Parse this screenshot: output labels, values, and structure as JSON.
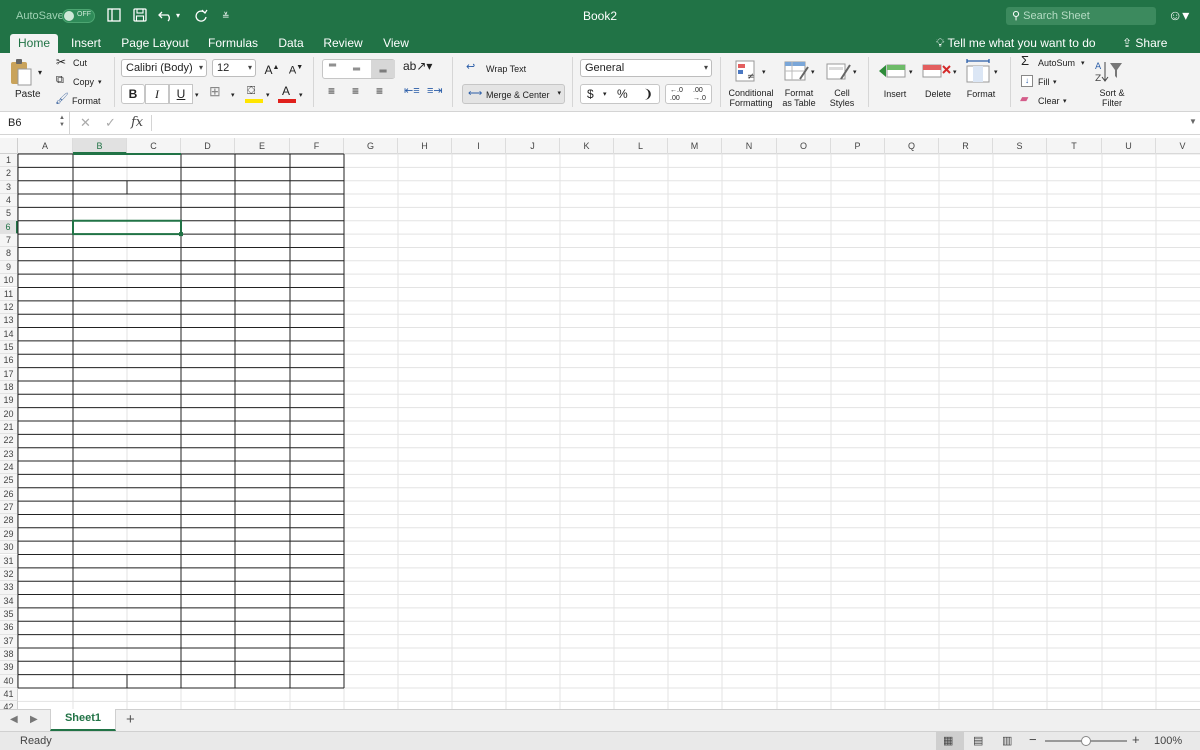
{
  "titlebar": {
    "autosave_label": "AutoSave",
    "autosave_state": "OFF",
    "title": "Book2",
    "search_placeholder": "Search Sheet"
  },
  "tabs": [
    {
      "label": "Home",
      "active": true
    },
    {
      "label": "Insert"
    },
    {
      "label": "Page Layout"
    },
    {
      "label": "Formulas"
    },
    {
      "label": "Data"
    },
    {
      "label": "Review"
    },
    {
      "label": "View"
    }
  ],
  "tell_me": "Tell me what you want to do",
  "share": "Share",
  "ribbon": {
    "paste": "Paste",
    "cut": "Cut",
    "copy": "Copy",
    "format_painter": "Format",
    "font_name": "Calibri (Body)",
    "font_size": "12",
    "bold": "B",
    "italic": "I",
    "underline": "U",
    "wrap_text": "Wrap Text",
    "merge_center": "Merge & Center",
    "number_format": "General",
    "currency": "$",
    "percent": "%",
    "comma": "❩",
    "conditional_formatting": [
      "Conditional",
      "Formatting"
    ],
    "format_as_table": [
      "Format",
      "as Table"
    ],
    "cell_styles": [
      "Cell",
      "Styles"
    ],
    "insert": "Insert",
    "delete": "Delete",
    "format": "Format",
    "autosum": "AutoSum",
    "fill": "Fill",
    "clear": "Clear",
    "sort_filter": [
      "Sort &",
      "Filter"
    ]
  },
  "formula_bar": {
    "name_box": "B6",
    "fx": "fx",
    "value": ""
  },
  "grid": {
    "columns": [
      "A",
      "B",
      "C",
      "D",
      "E",
      "F",
      "G",
      "H",
      "I",
      "J",
      "K",
      "L",
      "M",
      "N",
      "O",
      "P",
      "Q",
      "R",
      "S",
      "T",
      "U",
      "V"
    ],
    "rows": [
      "1",
      "2",
      "3",
      "4",
      "5",
      "6",
      "7",
      "8",
      "9",
      "10",
      "11",
      "12",
      "13",
      "14",
      "15",
      "16",
      "17",
      "18",
      "19",
      "20",
      "21",
      "22",
      "23",
      "24",
      "25",
      "26",
      "27",
      "28",
      "29",
      "30",
      "31",
      "32",
      "33",
      "34",
      "35",
      "36",
      "37",
      "38",
      "39",
      "40",
      "41",
      "42"
    ],
    "selected_cell": "B6",
    "active_column": "B",
    "active_row": "6"
  },
  "sheets": [
    {
      "label": "Sheet1",
      "active": true
    }
  ],
  "add_sheet": "+",
  "status": {
    "text": "Ready",
    "zoom": "100%",
    "zoom_minus": "−",
    "zoom_plus": "+",
    "zoom_level": 0.5
  },
  "colors": {
    "brand": "#217346",
    "selection": "#217346",
    "font_color_bar": "#e0201b",
    "highlight_bar": "#ffe500"
  }
}
